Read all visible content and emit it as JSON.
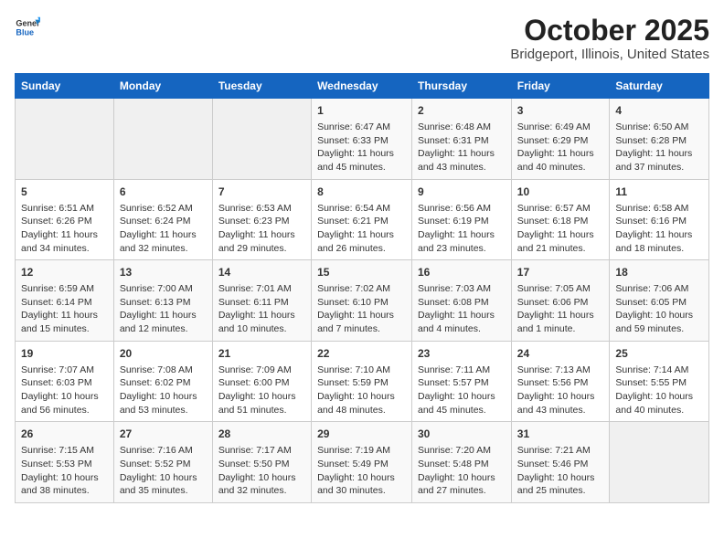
{
  "logo": {
    "general": "General",
    "blue": "Blue"
  },
  "title": "October 2025",
  "subtitle": "Bridgeport, Illinois, United States",
  "weekdays": [
    "Sunday",
    "Monday",
    "Tuesday",
    "Wednesday",
    "Thursday",
    "Friday",
    "Saturday"
  ],
  "weeks": [
    [
      {
        "day": "",
        "info": ""
      },
      {
        "day": "",
        "info": ""
      },
      {
        "day": "",
        "info": ""
      },
      {
        "day": "1",
        "info": "Sunrise: 6:47 AM\nSunset: 6:33 PM\nDaylight: 11 hours and 45 minutes."
      },
      {
        "day": "2",
        "info": "Sunrise: 6:48 AM\nSunset: 6:31 PM\nDaylight: 11 hours and 43 minutes."
      },
      {
        "day": "3",
        "info": "Sunrise: 6:49 AM\nSunset: 6:29 PM\nDaylight: 11 hours and 40 minutes."
      },
      {
        "day": "4",
        "info": "Sunrise: 6:50 AM\nSunset: 6:28 PM\nDaylight: 11 hours and 37 minutes."
      }
    ],
    [
      {
        "day": "5",
        "info": "Sunrise: 6:51 AM\nSunset: 6:26 PM\nDaylight: 11 hours and 34 minutes."
      },
      {
        "day": "6",
        "info": "Sunrise: 6:52 AM\nSunset: 6:24 PM\nDaylight: 11 hours and 32 minutes."
      },
      {
        "day": "7",
        "info": "Sunrise: 6:53 AM\nSunset: 6:23 PM\nDaylight: 11 hours and 29 minutes."
      },
      {
        "day": "8",
        "info": "Sunrise: 6:54 AM\nSunset: 6:21 PM\nDaylight: 11 hours and 26 minutes."
      },
      {
        "day": "9",
        "info": "Sunrise: 6:56 AM\nSunset: 6:19 PM\nDaylight: 11 hours and 23 minutes."
      },
      {
        "day": "10",
        "info": "Sunrise: 6:57 AM\nSunset: 6:18 PM\nDaylight: 11 hours and 21 minutes."
      },
      {
        "day": "11",
        "info": "Sunrise: 6:58 AM\nSunset: 6:16 PM\nDaylight: 11 hours and 18 minutes."
      }
    ],
    [
      {
        "day": "12",
        "info": "Sunrise: 6:59 AM\nSunset: 6:14 PM\nDaylight: 11 hours and 15 minutes."
      },
      {
        "day": "13",
        "info": "Sunrise: 7:00 AM\nSunset: 6:13 PM\nDaylight: 11 hours and 12 minutes."
      },
      {
        "day": "14",
        "info": "Sunrise: 7:01 AM\nSunset: 6:11 PM\nDaylight: 11 hours and 10 minutes."
      },
      {
        "day": "15",
        "info": "Sunrise: 7:02 AM\nSunset: 6:10 PM\nDaylight: 11 hours and 7 minutes."
      },
      {
        "day": "16",
        "info": "Sunrise: 7:03 AM\nSunset: 6:08 PM\nDaylight: 11 hours and 4 minutes."
      },
      {
        "day": "17",
        "info": "Sunrise: 7:05 AM\nSunset: 6:06 PM\nDaylight: 11 hours and 1 minute."
      },
      {
        "day": "18",
        "info": "Sunrise: 7:06 AM\nSunset: 6:05 PM\nDaylight: 10 hours and 59 minutes."
      }
    ],
    [
      {
        "day": "19",
        "info": "Sunrise: 7:07 AM\nSunset: 6:03 PM\nDaylight: 10 hours and 56 minutes."
      },
      {
        "day": "20",
        "info": "Sunrise: 7:08 AM\nSunset: 6:02 PM\nDaylight: 10 hours and 53 minutes."
      },
      {
        "day": "21",
        "info": "Sunrise: 7:09 AM\nSunset: 6:00 PM\nDaylight: 10 hours and 51 minutes."
      },
      {
        "day": "22",
        "info": "Sunrise: 7:10 AM\nSunset: 5:59 PM\nDaylight: 10 hours and 48 minutes."
      },
      {
        "day": "23",
        "info": "Sunrise: 7:11 AM\nSunset: 5:57 PM\nDaylight: 10 hours and 45 minutes."
      },
      {
        "day": "24",
        "info": "Sunrise: 7:13 AM\nSunset: 5:56 PM\nDaylight: 10 hours and 43 minutes."
      },
      {
        "day": "25",
        "info": "Sunrise: 7:14 AM\nSunset: 5:55 PM\nDaylight: 10 hours and 40 minutes."
      }
    ],
    [
      {
        "day": "26",
        "info": "Sunrise: 7:15 AM\nSunset: 5:53 PM\nDaylight: 10 hours and 38 minutes."
      },
      {
        "day": "27",
        "info": "Sunrise: 7:16 AM\nSunset: 5:52 PM\nDaylight: 10 hours and 35 minutes."
      },
      {
        "day": "28",
        "info": "Sunrise: 7:17 AM\nSunset: 5:50 PM\nDaylight: 10 hours and 32 minutes."
      },
      {
        "day": "29",
        "info": "Sunrise: 7:19 AM\nSunset: 5:49 PM\nDaylight: 10 hours and 30 minutes."
      },
      {
        "day": "30",
        "info": "Sunrise: 7:20 AM\nSunset: 5:48 PM\nDaylight: 10 hours and 27 minutes."
      },
      {
        "day": "31",
        "info": "Sunrise: 7:21 AM\nSunset: 5:46 PM\nDaylight: 10 hours and 25 minutes."
      },
      {
        "day": "",
        "info": ""
      }
    ]
  ]
}
